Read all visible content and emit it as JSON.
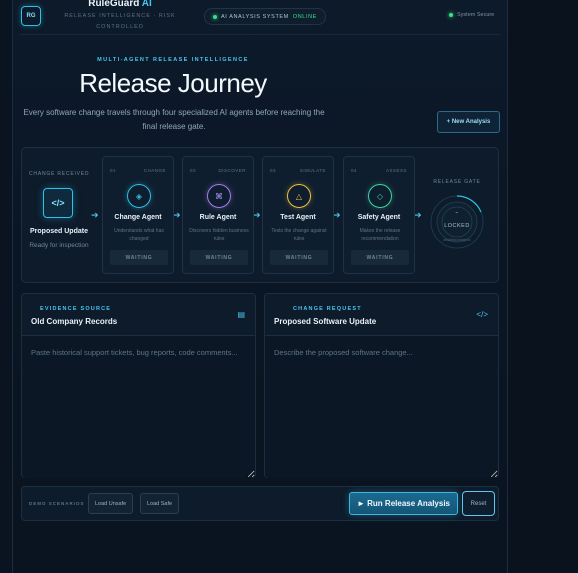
{
  "header": {
    "logo": "RG",
    "brand_name": "RuleGuard",
    "brand_ai": "AI",
    "brand_sub": "RELEASE INTELLIGENCE · RISK CONTROLLED",
    "status_label": "AI ANALYSIS SYSTEM",
    "status_value": "ONLINE",
    "secure_label": "System Secure"
  },
  "hero": {
    "kicker": "MULTI-AGENT RELEASE INTELLIGENCE",
    "title": "Release Journey",
    "description": "Every software change travels through four specialized AI agents before reaching the final release gate.",
    "new_analysis": "+ New Analysis"
  },
  "pipeline": {
    "change_label": "CHANGE RECEIVED",
    "proposed_icon": "</>",
    "proposed_title": "Proposed Update",
    "proposed_sub": "Ready for inspection",
    "agents": [
      {
        "num": "01",
        "tag": "CHANGE",
        "icon": "◈",
        "name": "Change Agent",
        "desc": "Understands what has changed",
        "status": "WAITING",
        "color": "#2ec0e8"
      },
      {
        "num": "02",
        "tag": "DISCOVER",
        "icon": "⌘",
        "name": "Rule Agent",
        "desc": "Discovers hidden business rules",
        "status": "WAITING",
        "color": "#a57df0"
      },
      {
        "num": "03",
        "tag": "SIMULATE",
        "icon": "△",
        "name": "Test Agent",
        "desc": "Tests the change against rules",
        "status": "WAITING",
        "color": "#f0c040"
      },
      {
        "num": "04",
        "tag": "ASSESS",
        "icon": "◇",
        "name": "Safety Agent",
        "desc": "Makes the release recommendation",
        "status": "WAITING",
        "color": "#38d6a0"
      }
    ],
    "gate_label": "RELEASE GATE",
    "gate_status": "LOCKED",
    "gate_sub": "awaiting analysis"
  },
  "evidence": {
    "kicker": "EVIDENCE SOURCE",
    "title": "Old Company Records",
    "icon": "▤",
    "placeholder": "Paste historical support tickets, bug reports, code comments..."
  },
  "change": {
    "kicker": "CHANGE REQUEST",
    "title": "Proposed Software Update",
    "icon": "</>",
    "placeholder": "Describe the proposed software change..."
  },
  "actions": {
    "demo_label": "DEMO SCENARIOS",
    "load_unsafe": "Load Unsafe",
    "load_safe": "Load Safe",
    "run": "► Run Release Analysis",
    "reset": "Reset"
  }
}
